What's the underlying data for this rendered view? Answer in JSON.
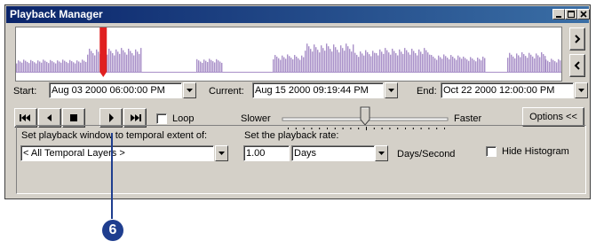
{
  "window": {
    "title": "Playback Manager"
  },
  "histogram": {
    "color": "#a88fc8",
    "marker_color": "#e02020",
    "marker_position": 0.16,
    "segments": [
      [
        0.0,
        0.13,
        0.28
      ],
      [
        0.13,
        0.23,
        0.55
      ],
      [
        0.33,
        0.38,
        0.3
      ],
      [
        0.47,
        0.53,
        0.4
      ],
      [
        0.53,
        0.62,
        0.65
      ],
      [
        0.62,
        0.66,
        0.5
      ],
      [
        0.66,
        0.76,
        0.55
      ],
      [
        0.76,
        0.82,
        0.4
      ],
      [
        0.82,
        0.86,
        0.35
      ],
      [
        0.9,
        0.97,
        0.45
      ],
      [
        0.97,
        1.0,
        0.3
      ]
    ]
  },
  "nav": {
    "forward_icon": "chevron-right-icon",
    "back_icon": "chevron-left-icon"
  },
  "time": {
    "start_label": "Start:",
    "start_value": "Aug 03 2000 06:00:00 PM",
    "current_label": "Current:",
    "current_value": "Aug 15 2000 09:19:44 PM",
    "end_label": "End:",
    "end_value": "Oct 22 2000 12:00:00 PM"
  },
  "controls": {
    "loop_label": "Loop",
    "loop_checked": false,
    "slower_label": "Slower",
    "faster_label": "Faster",
    "speed_level": 0.5,
    "options_label": "Options <<"
  },
  "settings": {
    "window_label": "Set playback window to temporal extent of:",
    "window_value": "< All Temporal Layers >",
    "rate_label": "Set the playback rate:",
    "rate_value": "1.00",
    "rate_unit": "Days",
    "rate_suffix": "Days/Second",
    "hide_histogram_label": "Hide Histogram",
    "hide_histogram_checked": false
  },
  "callout": {
    "number": "6"
  }
}
